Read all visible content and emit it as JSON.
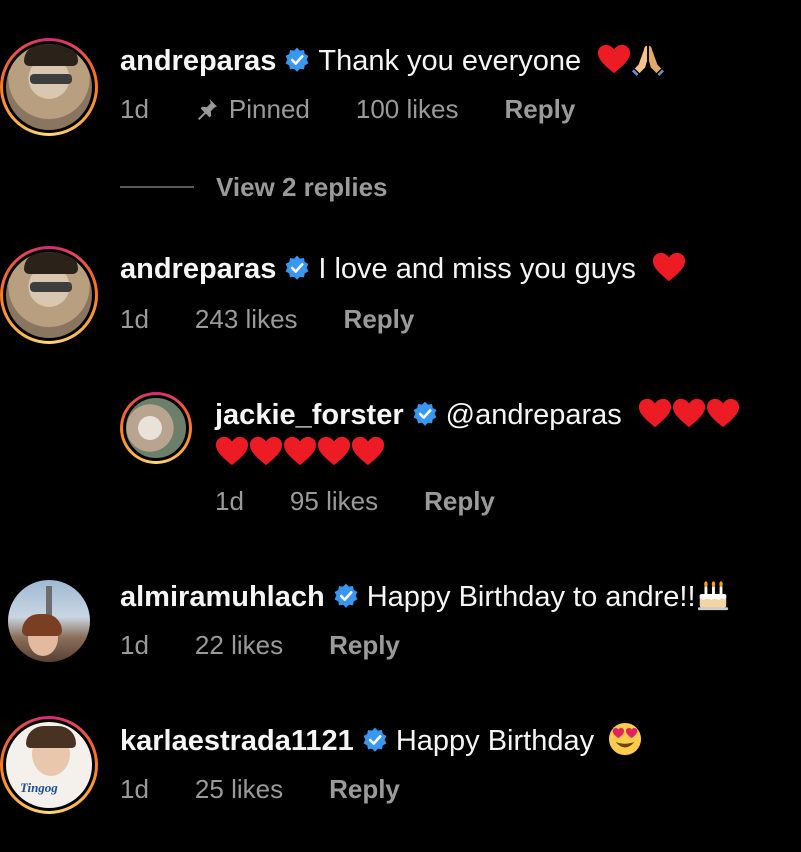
{
  "comments": [
    {
      "username": "andreparas",
      "text": "Thank you everyone",
      "time": "1d",
      "pinned_label": "Pinned",
      "likes": "100 likes",
      "reply": "Reply",
      "view_replies": "View 2 replies"
    },
    {
      "username": "andreparas",
      "text": "I love and miss you guys",
      "time": "1d",
      "likes": "243 likes",
      "reply": "Reply"
    },
    {
      "username": "jackie_forster",
      "text": "@andreparas",
      "time": "1d",
      "likes": "95 likes",
      "reply": "Reply"
    },
    {
      "username": "almiramuhlach",
      "text": "Happy Birthday to andre!!",
      "time": "1d",
      "likes": "22 likes",
      "reply": "Reply"
    },
    {
      "username": "karlaestrada1121",
      "text": "Happy Birthday",
      "time": "1d",
      "likes": "25 likes",
      "reply": "Reply",
      "avatar_caption": "Tingog"
    }
  ],
  "colors": {
    "background": "#000000",
    "text": "#f5f5f5",
    "muted": "#9a9a9a",
    "verified": "#3897f0",
    "heart": "#ed1c24"
  },
  "icons": [
    "verified-badge-icon",
    "pin-icon",
    "heart-emoji-icon",
    "folded-hands-emoji-icon",
    "birthday-cake-emoji-icon",
    "heart-eyes-emoji-icon"
  ]
}
